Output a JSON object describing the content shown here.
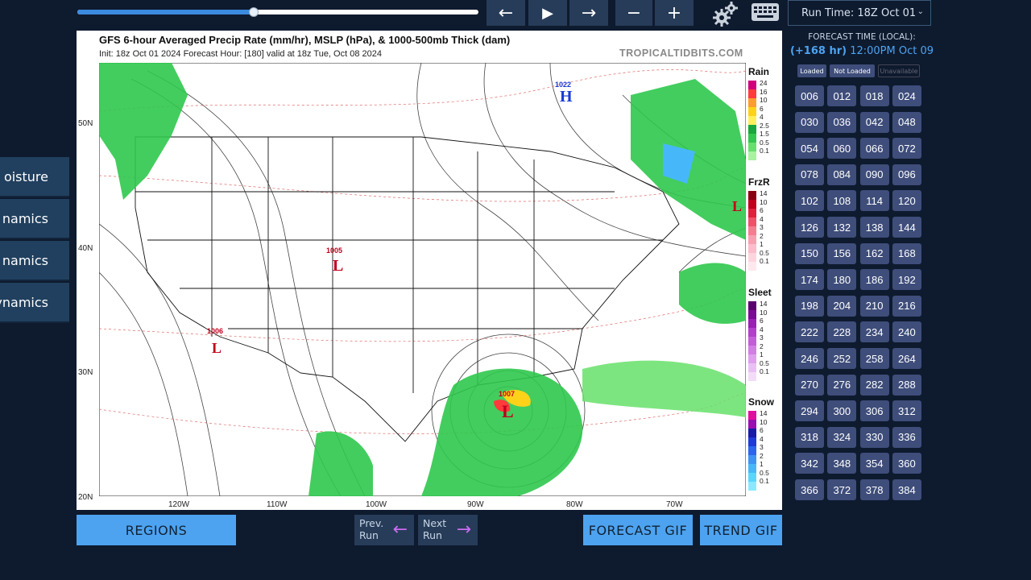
{
  "side_tabs": [
    "oisture",
    "namics",
    "namics",
    "ynamics"
  ],
  "toolbar": {
    "back": "←",
    "play": "▶",
    "forward": "→",
    "minus": "−",
    "plus": "+",
    "slider_progress": 0.44
  },
  "run_select": {
    "value": "Run Time: 18Z Oct 01"
  },
  "map": {
    "title": "GFS 6-hour Averaged Precip Rate (mm/hr), MSLP (hPa), & 1000-500mb Thick (dam)",
    "subtitle": "Init: 18z Oct 01 2024   Forecast Hour: [180]   valid at 18z Tue, Oct 08 2024",
    "credit": "TROPICALTIDBITS.COM",
    "lat_labels": [
      "50N",
      "40N",
      "30N",
      "20N"
    ],
    "lon_labels": [
      "120W",
      "110W",
      "100W",
      "90W",
      "80W",
      "70W"
    ],
    "pressure_labels": [
      "1022",
      "1005",
      "1006",
      "1007"
    ],
    "legend": [
      {
        "name": "Rain",
        "ticks": [
          "24",
          "16",
          "10",
          "6",
          "4",
          "2.5",
          "1.5",
          "0.5",
          "0.1"
        ],
        "colors": [
          "#d1007a",
          "#ff3b3b",
          "#ff9d2e",
          "#ffd21a",
          "#fff05c",
          "#17a83d",
          "#2fc84c",
          "#66e06a",
          "#a8f2a0"
        ]
      },
      {
        "name": "FrzR",
        "ticks": [
          "14",
          "10",
          "6",
          "4",
          "3",
          "2",
          "1",
          "0.5",
          "0.1"
        ],
        "colors": [
          "#8a0010",
          "#c0001c",
          "#e0203a",
          "#f0506a",
          "#f57d90",
          "#f8a0b0",
          "#fbbccb",
          "#fdd5df",
          "#fee8ee"
        ]
      },
      {
        "name": "Sleet",
        "ticks": [
          "14",
          "10",
          "6",
          "4",
          "3",
          "2",
          "1",
          "0.5",
          "0.1"
        ],
        "colors": [
          "#5a006e",
          "#7a0b94",
          "#9b1fb5",
          "#b33ecb",
          "#c45ed8",
          "#d27fe3",
          "#dea0ec",
          "#e9c0f3",
          "#f3dcf8"
        ]
      },
      {
        "name": "Snow",
        "ticks": [
          "14",
          "10",
          "6",
          "4",
          "3",
          "2",
          "1",
          "0.5",
          "0.1"
        ],
        "colors": [
          "#e0109e",
          "#9a0fb3",
          "#1a1aa8",
          "#1f3ad6",
          "#2b66ec",
          "#3d94f5",
          "#46b8fa",
          "#5ad6fc",
          "#8ae9ff"
        ]
      }
    ]
  },
  "bottom": {
    "regions": "REGIONS",
    "prev_run_l1": "Prev.",
    "prev_run_l2": "Run",
    "next_run_l1": "Next",
    "next_run_l2": "Run",
    "forecast_gif": "FORECAST GIF",
    "trend_gif": "TREND GIF"
  },
  "panel": {
    "forecast_label": "FORECAST TIME (LOCAL):",
    "forecast_hours": "(+168 hr)",
    "forecast_time": "12:00PM Oct 09",
    "status_loaded": "Loaded",
    "status_not_loaded": "Not Loaded",
    "status_unavailable": "Unavailable",
    "hours": [
      "006",
      "012",
      "018",
      "024",
      "030",
      "036",
      "042",
      "048",
      "054",
      "060",
      "066",
      "072",
      "078",
      "084",
      "090",
      "096",
      "102",
      "108",
      "114",
      "120",
      "126",
      "132",
      "138",
      "144",
      "150",
      "156",
      "162",
      "168",
      "174",
      "180",
      "186",
      "192",
      "198",
      "204",
      "210",
      "216",
      "222",
      "228",
      "234",
      "240",
      "246",
      "252",
      "258",
      "264",
      "270",
      "276",
      "282",
      "288",
      "294",
      "300",
      "306",
      "312",
      "318",
      "324",
      "330",
      "336",
      "342",
      "348",
      "354",
      "360",
      "366",
      "372",
      "378",
      "384"
    ]
  },
  "colors": {
    "accent": "#4da3f0",
    "button": "#3e4d7a",
    "background": "#0e1a2e"
  }
}
